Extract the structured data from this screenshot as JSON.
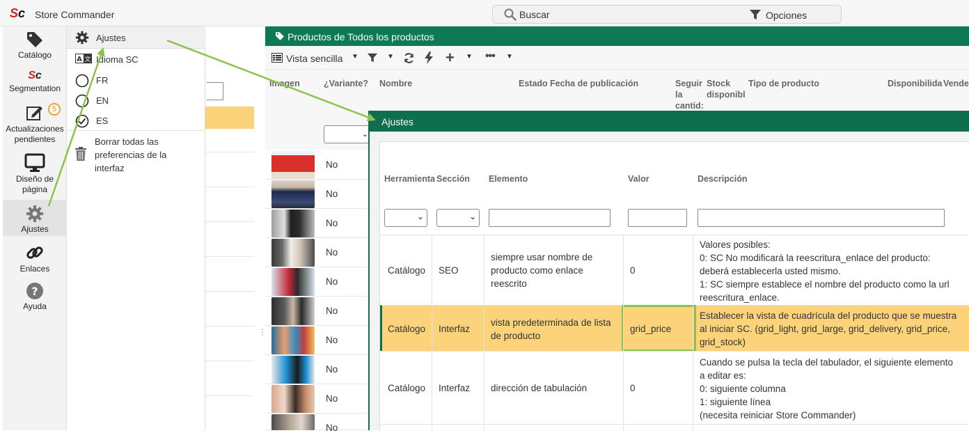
{
  "app": {
    "logo": "Sc",
    "title": "Store Commander"
  },
  "search": {
    "label": "Buscar",
    "options_label": "Opciones"
  },
  "nav": {
    "catalog": "Catálogo",
    "segmentation": "Segmentation",
    "updates_line1": "Actualizaciones",
    "updates_line2": "pendientes",
    "updates_badge": "5",
    "design_line1": "Diseño de",
    "design_line2": "página",
    "settings": "Ajustes",
    "links": "Enlaces",
    "help": "Ayuda"
  },
  "menu": {
    "settings": "Ajustes",
    "language": "Idioma SC",
    "lang_fr": "FR",
    "lang_en": "EN",
    "lang_es": "ES",
    "clear_line1": "Borrar todas las",
    "clear_line2": "preferencias de la",
    "clear_line3": "interfaz"
  },
  "products": {
    "header": "Productos de Todos los productos",
    "view_label": "Vista sencilla",
    "columns": {
      "image": "Imagen",
      "variant": "¿Variante?",
      "name": "Nombre",
      "state": "Estado",
      "pub_date": "Fecha de publicación",
      "follow_line1": "Seguir",
      "follow_line2": "la",
      "follow_line3": "cantid:",
      "stock_line1": "Stock",
      "stock_line2": "disponibl",
      "type": "Tipo de producto",
      "availability": "Disponibilida",
      "sell": "Vende"
    },
    "rows": [
      "No",
      "No",
      "No",
      "No",
      "No",
      "No",
      "No",
      "No",
      "No",
      "No"
    ]
  },
  "modal": {
    "title": "Ajustes",
    "columns": {
      "tool": "Herramienta",
      "section": "Sección",
      "element": "Elemento",
      "value": "Valor",
      "description": "Descripción"
    },
    "rows": [
      {
        "tool": "Catálogo",
        "section": "SEO",
        "element": [
          "siempre usar nombre de",
          "producto como enlace",
          "reescrito"
        ],
        "value": "0",
        "description": [
          "Valores posibles:",
          "0: SC No modificará la reescritura_enlace del producto:",
          "deberá establecerla usted mismo.",
          "1: SC siempre establece el nombre del producto como la url",
          "reescritura_enlace."
        ]
      },
      {
        "tool": "Catálogo",
        "section": "Interfaz",
        "element": [
          "vista predeterminada de lista",
          "de producto"
        ],
        "value": "grid_price",
        "description": [
          "Establecer la vista de cuadrícula del producto que se muestra",
          "al iniciar SC. (grid_light, grid_large, grid_delivery, grid_price,",
          "grid_stock)"
        ]
      },
      {
        "tool": "Catálogo",
        "section": "Interfaz",
        "element": [
          "dirección de tabulación"
        ],
        "value": "0",
        "description": [
          "Cuando se pulsa la tecla del tabulador, el siguiente elemento",
          "a editar es:",
          "0: siguiente columna",
          "1: siguiente línea",
          "(necesita reiniciar Store Commander)"
        ]
      }
    ]
  },
  "colors": {
    "brand_green": "#0e7a55",
    "modal_green": "#0e6e4d",
    "selected_row": "#fcd37a",
    "annotation": "#8bc34a",
    "logo_red": "#d2211f"
  }
}
